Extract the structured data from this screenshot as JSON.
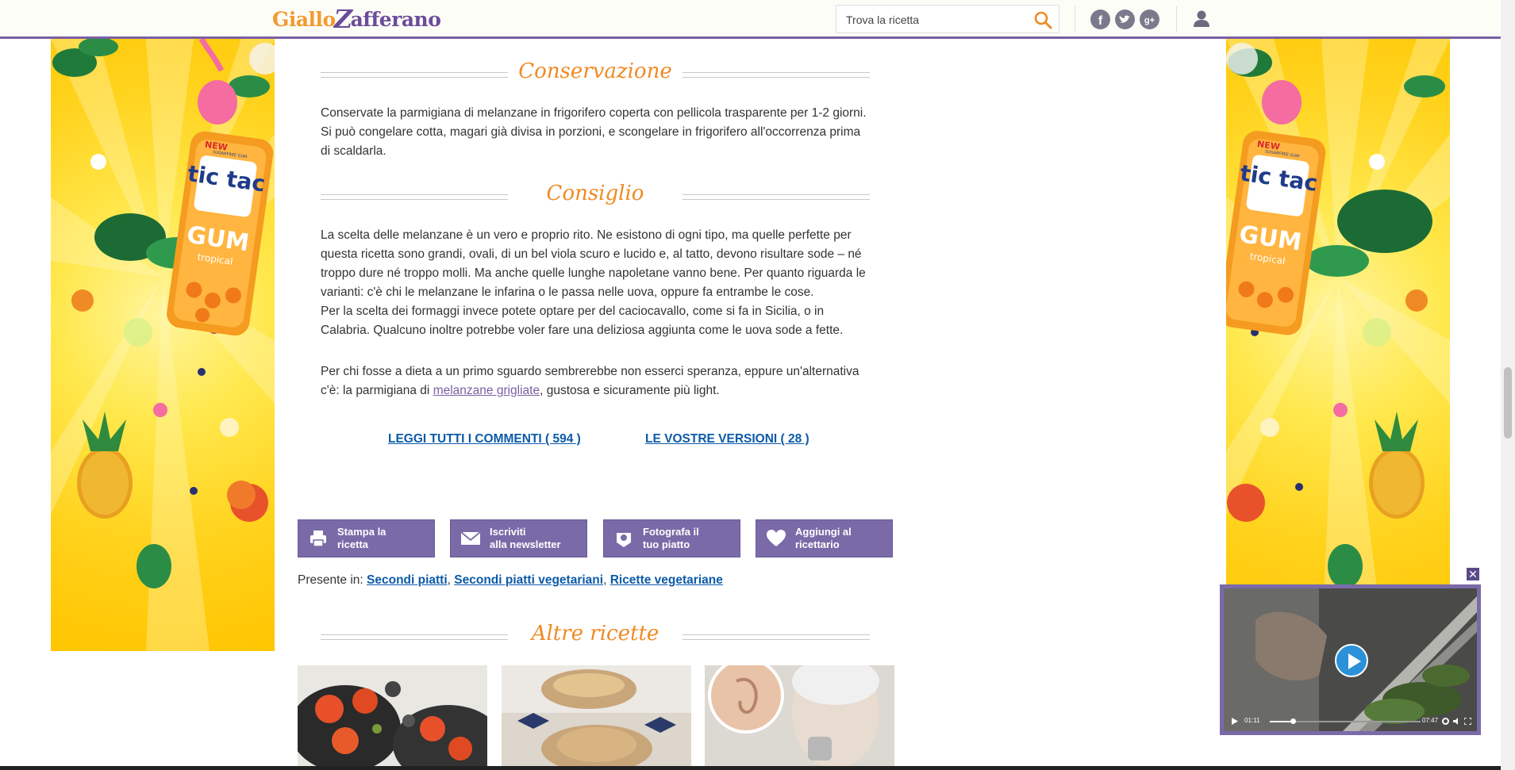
{
  "header": {
    "logo_part1": "Giallo",
    "logo_part2": "Z",
    "logo_part3": "afferano",
    "search_placeholder": "Trova la ricetta",
    "icons": [
      "search-icon",
      "facebook-icon",
      "twitter-icon",
      "google-plus-icon",
      "user-icon"
    ]
  },
  "ads": {
    "brand": "tic tac",
    "product": "GUM",
    "flavor": "tropical",
    "badge": "NEW",
    "tagline": "SUGARFREE GUM"
  },
  "sections": {
    "conservazione": {
      "title": "Conservazione",
      "text": "Conservate la parmigiana di melanzane in frigorifero coperta con pellicola trasparente per 1-2 giorni. Si può congelare cotta, magari già divisa in porzioni, e scongelare in frigorifero all'occorrenza prima di scaldarla."
    },
    "consiglio": {
      "title": "Consiglio",
      "p1": "La scelta delle melanzane è un vero e proprio rito. Ne esistono di ogni tipo, ma quelle perfette per questa ricetta sono grandi, ovali, di un bel viola scuro e lucido e, al tatto, devono risultare sode – né troppo dure né troppo molli. Ma anche quelle lunghe napoletane vanno bene. Per quanto riguarda le varianti: c'è chi le melanzane le infarina o le passa nelle uova, oppure fa entrambe le cose.",
      "p2": "Per la scelta dei formaggi invece potete optare per del caciocavallo, come si fa in Sicilia, o in Calabria. Qualcuno inoltre potrebbe voler fare una deliziosa aggiunta come le uova sode a fette.",
      "p3_before": "Per chi fosse a dieta a un primo sguardo sembrerebbe non esserci speranza, eppure un'alternativa c'è: la parmigiana di ",
      "p3_link": "melanzane grigliate",
      "p3_after": ", gustosa e sicuramente più light."
    },
    "altre_ricette": {
      "title": "Altre ricette"
    }
  },
  "links": {
    "comments": "LEGGI TUTTI I COMMENTI ( 594 )",
    "versions": "LE VOSTRE VERSIONI ( 28 )"
  },
  "actions": [
    {
      "label": "Stampa la\nricetta",
      "icon": "print-icon"
    },
    {
      "label": "Iscriviti\nalla newsletter",
      "icon": "mail-icon"
    },
    {
      "label": "Fotografa il\ntuo piatto",
      "icon": "camera-icon"
    },
    {
      "label": "Aggiungi al\nricettario",
      "icon": "heart-icon"
    }
  ],
  "categories": {
    "prefix": "Presente in:",
    "items": [
      "Secondi piatti",
      "Secondi piatti vegetariani",
      "Ricette vegetariane"
    ],
    "separator": ","
  },
  "video": {
    "current_time": "01:11",
    "duration": "07:47",
    "progress": 0.15,
    "close_label": "✕"
  },
  "colors": {
    "brand_purple": "#7a5fa3",
    "brand_orange": "#f08a24",
    "link_blue": "#0b5aa8",
    "button_purple": "#7a6aa8"
  }
}
